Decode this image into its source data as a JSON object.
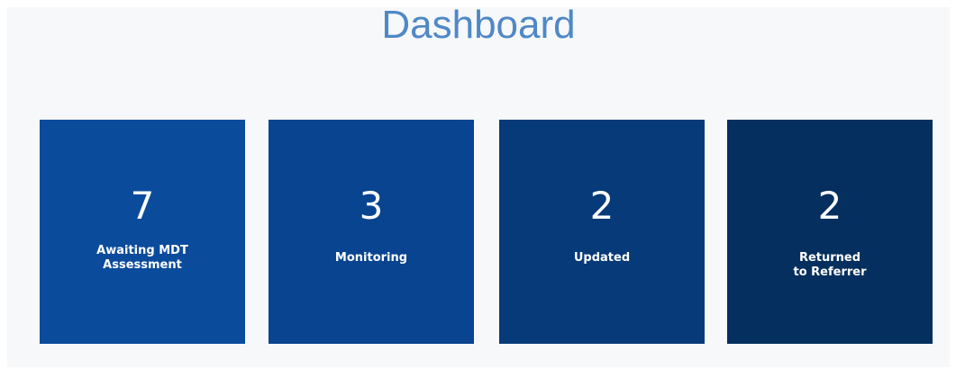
{
  "page": {
    "title": "Dashboard"
  },
  "tiles": [
    {
      "count": "7",
      "label": "Awaiting MDT\nAssessment",
      "color": "#0a4b9c"
    },
    {
      "count": "3",
      "label": "Monitoring",
      "color": "#084490"
    },
    {
      "count": "2",
      "label": "Updated",
      "color": "#073a78"
    },
    {
      "count": "2",
      "label": "Returned\nto Referrer",
      "color": "#052f5e"
    }
  ]
}
